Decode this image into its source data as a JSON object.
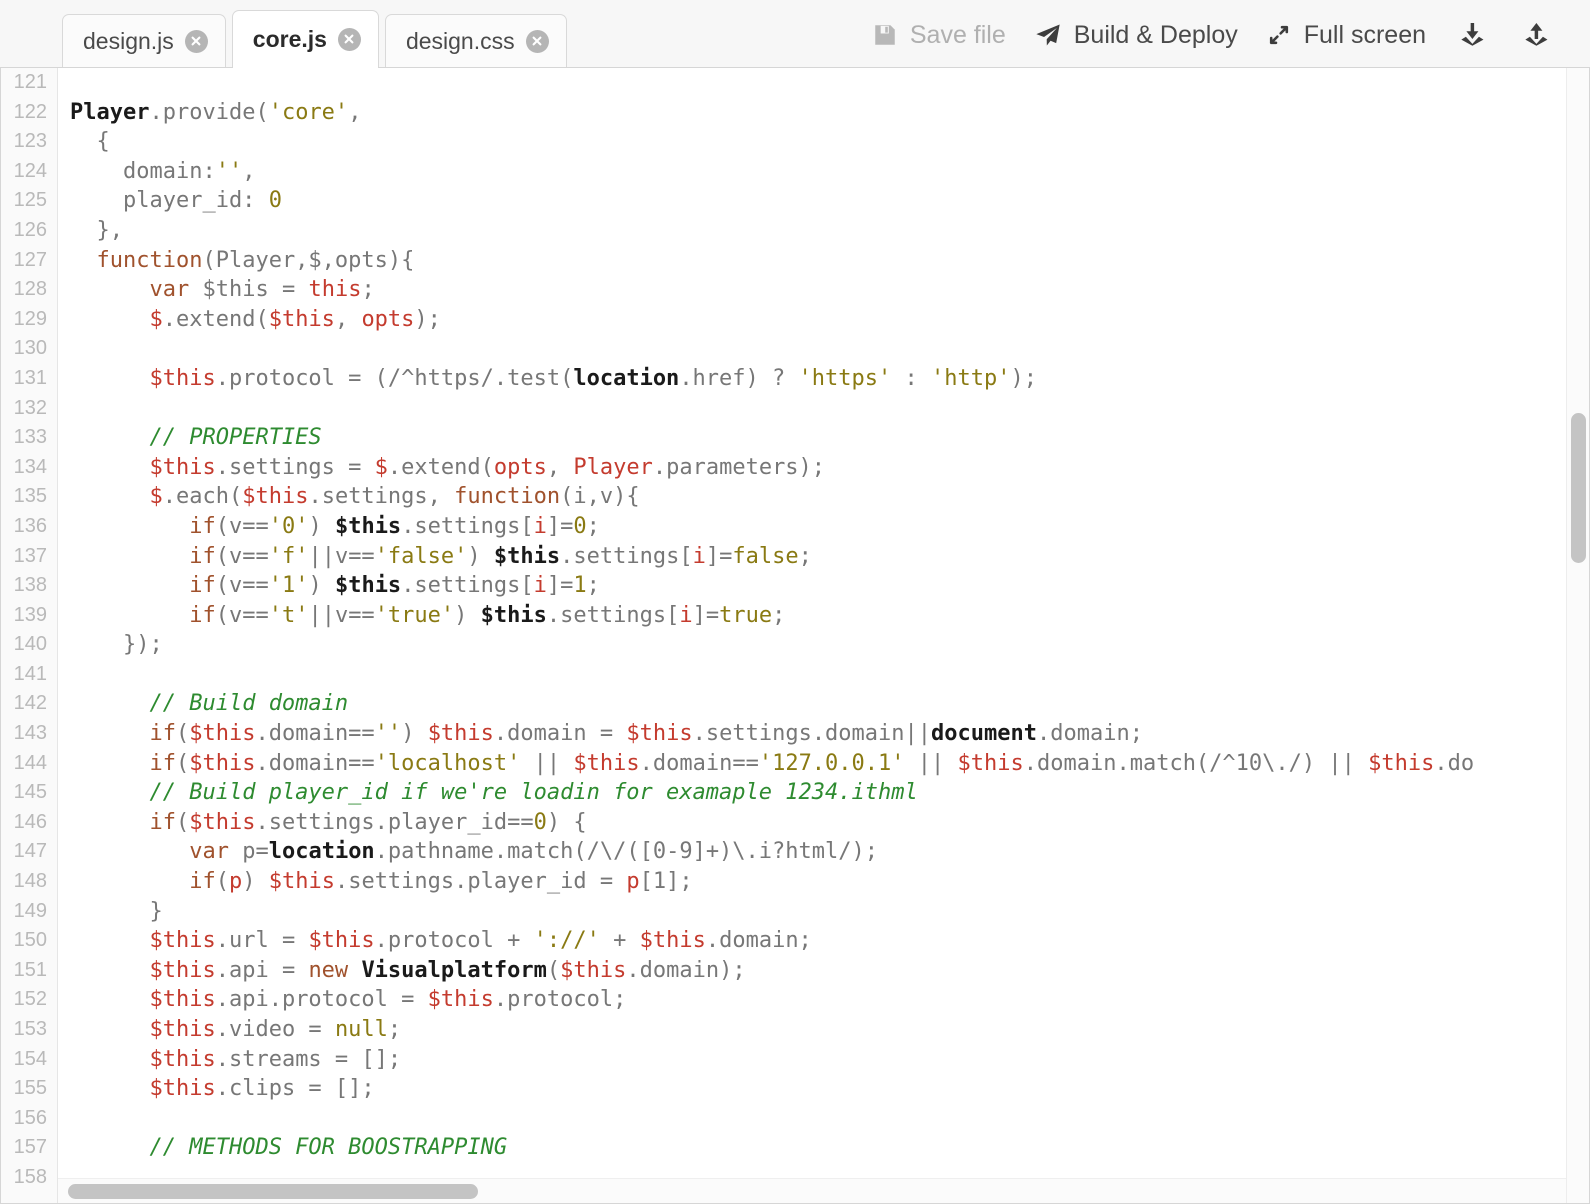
{
  "tabs": [
    {
      "label": "design.js",
      "active": false,
      "close_icon": "close-circle-icon"
    },
    {
      "label": "core.js",
      "active": true,
      "close_icon": "close-circle-icon"
    },
    {
      "label": "design.css",
      "active": false,
      "close_icon": "close-circle-icon"
    }
  ],
  "toolbar": {
    "save_label": "Save file",
    "save_icon": "floppy-disk-icon",
    "save_disabled": true,
    "build_label": "Build & Deploy",
    "build_icon": "paper-plane-icon",
    "fullscreen_label": "Full screen",
    "fullscreen_icon": "expand-arrows-icon",
    "download_icon": "download-icon",
    "upload_icon": "upload-icon"
  },
  "editor": {
    "language": "javascript",
    "first_line": 121,
    "last_line": 158,
    "line_numbers": [
      121,
      122,
      123,
      124,
      125,
      126,
      127,
      128,
      129,
      130,
      131,
      132,
      133,
      134,
      135,
      136,
      137,
      138,
      139,
      140,
      141,
      142,
      143,
      144,
      145,
      146,
      147,
      148,
      149,
      150,
      151,
      152,
      153,
      154,
      155,
      156,
      157,
      158
    ],
    "colors": {
      "keyword": "#a0522d",
      "variable": "#c43b2e",
      "string": "#8a7a13",
      "number": "#8a7a13",
      "comment": "#2e8b30",
      "global": "#1a1a1a",
      "default": "#777777",
      "gutter_text": "#bbbbbb",
      "background": "#ffffff"
    },
    "lines": [
      {
        "n": 121,
        "tokens": []
      },
      {
        "n": 122,
        "tokens": [
          {
            "t": "glob",
            "s": "Player"
          },
          {
            "t": "def",
            "s": ".provide("
          },
          {
            "t": "str",
            "s": "'core'"
          },
          {
            "t": "def",
            "s": ","
          }
        ]
      },
      {
        "n": 123,
        "tokens": [
          {
            "t": "def",
            "s": "  {"
          }
        ]
      },
      {
        "n": 124,
        "tokens": [
          {
            "t": "def",
            "s": "    domain:"
          },
          {
            "t": "str",
            "s": "''"
          },
          {
            "t": "def",
            "s": ","
          }
        ]
      },
      {
        "n": 125,
        "tokens": [
          {
            "t": "def",
            "s": "    player_id: "
          },
          {
            "t": "num",
            "s": "0"
          }
        ]
      },
      {
        "n": 126,
        "tokens": [
          {
            "t": "def",
            "s": "  },"
          }
        ]
      },
      {
        "n": 127,
        "tokens": [
          {
            "t": "def",
            "s": "  "
          },
          {
            "t": "kw",
            "s": "function"
          },
          {
            "t": "def",
            "s": "(Player,$,opts){"
          }
        ]
      },
      {
        "n": 128,
        "tokens": [
          {
            "t": "def",
            "s": "      "
          },
          {
            "t": "kw",
            "s": "var"
          },
          {
            "t": "def",
            "s": " $this = "
          },
          {
            "t": "var",
            "s": "this"
          },
          {
            "t": "def",
            "s": ";"
          }
        ]
      },
      {
        "n": 129,
        "tokens": [
          {
            "t": "def",
            "s": "      "
          },
          {
            "t": "var",
            "s": "$"
          },
          {
            "t": "def",
            "s": ".extend("
          },
          {
            "t": "var",
            "s": "$this"
          },
          {
            "t": "def",
            "s": ", "
          },
          {
            "t": "var",
            "s": "opts"
          },
          {
            "t": "def",
            "s": ");"
          }
        ]
      },
      {
        "n": 130,
        "tokens": []
      },
      {
        "n": 131,
        "tokens": [
          {
            "t": "def",
            "s": "      "
          },
          {
            "t": "var",
            "s": "$this"
          },
          {
            "t": "def",
            "s": ".protocol = (/^https/.test("
          },
          {
            "t": "glob",
            "s": "location"
          },
          {
            "t": "def",
            "s": ".href) ? "
          },
          {
            "t": "str",
            "s": "'https'"
          },
          {
            "t": "def",
            "s": " : "
          },
          {
            "t": "str",
            "s": "'http'"
          },
          {
            "t": "def",
            "s": ");"
          }
        ]
      },
      {
        "n": 132,
        "tokens": []
      },
      {
        "n": 133,
        "tokens": [
          {
            "t": "def",
            "s": "      "
          },
          {
            "t": "com",
            "s": "// PROPERTIES"
          }
        ]
      },
      {
        "n": 134,
        "tokens": [
          {
            "t": "def",
            "s": "      "
          },
          {
            "t": "var",
            "s": "$this"
          },
          {
            "t": "def",
            "s": ".settings = "
          },
          {
            "t": "var",
            "s": "$"
          },
          {
            "t": "def",
            "s": ".extend("
          },
          {
            "t": "var",
            "s": "opts"
          },
          {
            "t": "def",
            "s": ", "
          },
          {
            "t": "var",
            "s": "Player"
          },
          {
            "t": "def",
            "s": ".parameters);"
          }
        ]
      },
      {
        "n": 135,
        "tokens": [
          {
            "t": "def",
            "s": "      "
          },
          {
            "t": "var",
            "s": "$"
          },
          {
            "t": "def",
            "s": ".each("
          },
          {
            "t": "var",
            "s": "$this"
          },
          {
            "t": "def",
            "s": ".settings, "
          },
          {
            "t": "kw",
            "s": "function"
          },
          {
            "t": "def",
            "s": "(i,v){"
          }
        ]
      },
      {
        "n": 136,
        "tokens": [
          {
            "t": "def",
            "s": "         "
          },
          {
            "t": "kw",
            "s": "if"
          },
          {
            "t": "def",
            "s": "(v=="
          },
          {
            "t": "str",
            "s": "'0'"
          },
          {
            "t": "def",
            "s": ") "
          },
          {
            "t": "glob",
            "s": "$this"
          },
          {
            "t": "def",
            "s": ".settings["
          },
          {
            "t": "var",
            "s": "i"
          },
          {
            "t": "def",
            "s": "]="
          },
          {
            "t": "num",
            "s": "0"
          },
          {
            "t": "def",
            "s": ";"
          }
        ]
      },
      {
        "n": 137,
        "tokens": [
          {
            "t": "def",
            "s": "         "
          },
          {
            "t": "kw",
            "s": "if"
          },
          {
            "t": "def",
            "s": "(v=="
          },
          {
            "t": "str",
            "s": "'f'"
          },
          {
            "t": "def",
            "s": "||v=="
          },
          {
            "t": "str",
            "s": "'false'"
          },
          {
            "t": "def",
            "s": ") "
          },
          {
            "t": "glob",
            "s": "$this"
          },
          {
            "t": "def",
            "s": ".settings["
          },
          {
            "t": "var",
            "s": "i"
          },
          {
            "t": "def",
            "s": "]="
          },
          {
            "t": "num",
            "s": "false"
          },
          {
            "t": "def",
            "s": ";"
          }
        ]
      },
      {
        "n": 138,
        "tokens": [
          {
            "t": "def",
            "s": "         "
          },
          {
            "t": "kw",
            "s": "if"
          },
          {
            "t": "def",
            "s": "(v=="
          },
          {
            "t": "str",
            "s": "'1'"
          },
          {
            "t": "def",
            "s": ") "
          },
          {
            "t": "glob",
            "s": "$this"
          },
          {
            "t": "def",
            "s": ".settings["
          },
          {
            "t": "var",
            "s": "i"
          },
          {
            "t": "def",
            "s": "]="
          },
          {
            "t": "num",
            "s": "1"
          },
          {
            "t": "def",
            "s": ";"
          }
        ]
      },
      {
        "n": 139,
        "tokens": [
          {
            "t": "def",
            "s": "         "
          },
          {
            "t": "kw",
            "s": "if"
          },
          {
            "t": "def",
            "s": "(v=="
          },
          {
            "t": "str",
            "s": "'t'"
          },
          {
            "t": "def",
            "s": "||v=="
          },
          {
            "t": "str",
            "s": "'true'"
          },
          {
            "t": "def",
            "s": ") "
          },
          {
            "t": "glob",
            "s": "$this"
          },
          {
            "t": "def",
            "s": ".settings["
          },
          {
            "t": "var",
            "s": "i"
          },
          {
            "t": "def",
            "s": "]="
          },
          {
            "t": "num",
            "s": "true"
          },
          {
            "t": "def",
            "s": ";"
          }
        ]
      },
      {
        "n": 140,
        "tokens": [
          {
            "t": "def",
            "s": "    });"
          }
        ]
      },
      {
        "n": 141,
        "tokens": []
      },
      {
        "n": 142,
        "tokens": [
          {
            "t": "def",
            "s": "      "
          },
          {
            "t": "com",
            "s": "// Build domain"
          }
        ]
      },
      {
        "n": 143,
        "tokens": [
          {
            "t": "def",
            "s": "      "
          },
          {
            "t": "kw",
            "s": "if"
          },
          {
            "t": "def",
            "s": "("
          },
          {
            "t": "var",
            "s": "$this"
          },
          {
            "t": "def",
            "s": ".domain=="
          },
          {
            "t": "str",
            "s": "''"
          },
          {
            "t": "def",
            "s": ") "
          },
          {
            "t": "var",
            "s": "$this"
          },
          {
            "t": "def",
            "s": ".domain = "
          },
          {
            "t": "var",
            "s": "$this"
          },
          {
            "t": "def",
            "s": ".settings.domain||"
          },
          {
            "t": "glob",
            "s": "document"
          },
          {
            "t": "def",
            "s": ".domain;"
          }
        ]
      },
      {
        "n": 144,
        "tokens": [
          {
            "t": "def",
            "s": "      "
          },
          {
            "t": "kw",
            "s": "if"
          },
          {
            "t": "def",
            "s": "("
          },
          {
            "t": "var",
            "s": "$this"
          },
          {
            "t": "def",
            "s": ".domain=="
          },
          {
            "t": "str",
            "s": "'localhost'"
          },
          {
            "t": "def",
            "s": " || "
          },
          {
            "t": "var",
            "s": "$this"
          },
          {
            "t": "def",
            "s": ".domain=="
          },
          {
            "t": "str",
            "s": "'127.0.0.1'"
          },
          {
            "t": "def",
            "s": " || "
          },
          {
            "t": "var",
            "s": "$this"
          },
          {
            "t": "def",
            "s": ".domain.match(/^10\\./) || "
          },
          {
            "t": "var",
            "s": "$this"
          },
          {
            "t": "def",
            "s": ".do"
          }
        ]
      },
      {
        "n": 145,
        "tokens": [
          {
            "t": "def",
            "s": "      "
          },
          {
            "t": "com",
            "s": "// Build player_id if we're loadin for examaple 1234.ithml"
          }
        ]
      },
      {
        "n": 146,
        "tokens": [
          {
            "t": "def",
            "s": "      "
          },
          {
            "t": "kw",
            "s": "if"
          },
          {
            "t": "def",
            "s": "("
          },
          {
            "t": "var",
            "s": "$this"
          },
          {
            "t": "def",
            "s": ".settings.player_id=="
          },
          {
            "t": "num",
            "s": "0"
          },
          {
            "t": "def",
            "s": ") {"
          }
        ]
      },
      {
        "n": 147,
        "tokens": [
          {
            "t": "def",
            "s": "         "
          },
          {
            "t": "kw",
            "s": "var"
          },
          {
            "t": "def",
            "s": " p="
          },
          {
            "t": "glob",
            "s": "location"
          },
          {
            "t": "def",
            "s": ".pathname.match(/\\/([0-9]+)\\.i?html/);"
          }
        ]
      },
      {
        "n": 148,
        "tokens": [
          {
            "t": "def",
            "s": "         "
          },
          {
            "t": "kw",
            "s": "if"
          },
          {
            "t": "def",
            "s": "("
          },
          {
            "t": "var",
            "s": "p"
          },
          {
            "t": "def",
            "s": ") "
          },
          {
            "t": "var",
            "s": "$this"
          },
          {
            "t": "def",
            "s": ".settings.player_id = "
          },
          {
            "t": "var",
            "s": "p"
          },
          {
            "t": "def",
            "s": "[1];"
          }
        ]
      },
      {
        "n": 149,
        "tokens": [
          {
            "t": "def",
            "s": "      }"
          }
        ]
      },
      {
        "n": 150,
        "tokens": [
          {
            "t": "def",
            "s": "      "
          },
          {
            "t": "var",
            "s": "$this"
          },
          {
            "t": "def",
            "s": ".url = "
          },
          {
            "t": "var",
            "s": "$this"
          },
          {
            "t": "def",
            "s": ".protocol + "
          },
          {
            "t": "str",
            "s": "'://'"
          },
          {
            "t": "def",
            "s": " + "
          },
          {
            "t": "var",
            "s": "$this"
          },
          {
            "t": "def",
            "s": ".domain;"
          }
        ]
      },
      {
        "n": 151,
        "tokens": [
          {
            "t": "def",
            "s": "      "
          },
          {
            "t": "var",
            "s": "$this"
          },
          {
            "t": "def",
            "s": ".api = "
          },
          {
            "t": "kw",
            "s": "new"
          },
          {
            "t": "def",
            "s": " "
          },
          {
            "t": "glob",
            "s": "Visualplatform"
          },
          {
            "t": "def",
            "s": "("
          },
          {
            "t": "var",
            "s": "$this"
          },
          {
            "t": "def",
            "s": ".domain);"
          }
        ]
      },
      {
        "n": 152,
        "tokens": [
          {
            "t": "def",
            "s": "      "
          },
          {
            "t": "var",
            "s": "$this"
          },
          {
            "t": "def",
            "s": ".api.protocol = "
          },
          {
            "t": "var",
            "s": "$this"
          },
          {
            "t": "def",
            "s": ".protocol;"
          }
        ]
      },
      {
        "n": 153,
        "tokens": [
          {
            "t": "def",
            "s": "      "
          },
          {
            "t": "var",
            "s": "$this"
          },
          {
            "t": "def",
            "s": ".video = "
          },
          {
            "t": "num",
            "s": "null"
          },
          {
            "t": "def",
            "s": ";"
          }
        ]
      },
      {
        "n": 154,
        "tokens": [
          {
            "t": "def",
            "s": "      "
          },
          {
            "t": "var",
            "s": "$this"
          },
          {
            "t": "def",
            "s": ".streams = [];"
          }
        ]
      },
      {
        "n": 155,
        "tokens": [
          {
            "t": "def",
            "s": "      "
          },
          {
            "t": "var",
            "s": "$this"
          },
          {
            "t": "def",
            "s": ".clips = [];"
          }
        ]
      },
      {
        "n": 156,
        "tokens": []
      },
      {
        "n": 157,
        "tokens": [
          {
            "t": "def",
            "s": "      "
          },
          {
            "t": "com",
            "s": "// METHODS FOR BOOSTRAPPING"
          }
        ]
      },
      {
        "n": 158,
        "tokens": []
      }
    ]
  },
  "scrollbars": {
    "vertical_thumb_position_pct": 33,
    "horizontal_thumb_position_pct": 2
  }
}
